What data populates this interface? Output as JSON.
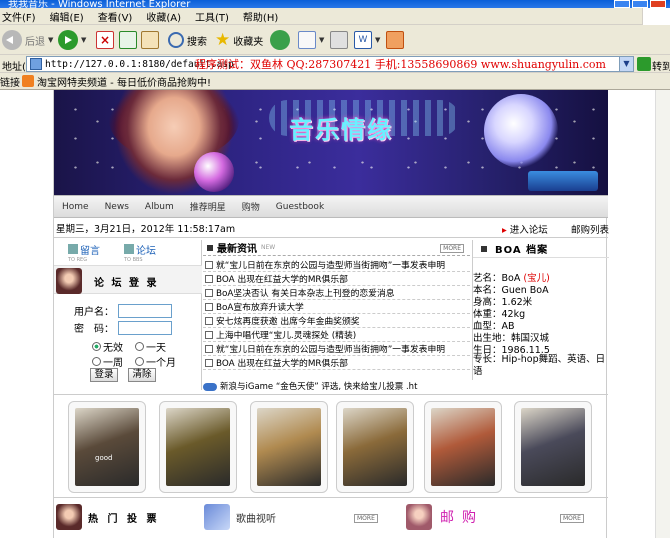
{
  "window": {
    "title": "我我音乐 - Windows Internet Explorer"
  },
  "menu": [
    "文件(F)",
    "编辑(E)",
    "查看(V)",
    "收藏(A)",
    "工具(T)",
    "帮助(H)"
  ],
  "toolbar": {
    "back": "后退",
    "search": "搜索",
    "favorites": "收藏夹"
  },
  "address": {
    "label": "地址(D)",
    "url": "http://127.0.0.1:8180/default.asp",
    "overlay": "程序测试：双鱼林 QQ:287307421 手机:13558690869 www.shuangyulin.com",
    "go": "转到"
  },
  "links": {
    "label": "链接",
    "item": "淘宝网特卖频道 - 每日低价商品抢购中!"
  },
  "banner": {
    "logo_text": "音乐情缘"
  },
  "nav": [
    "Home",
    "News",
    "Album",
    "推荐明星",
    "购物",
    "Guestbook"
  ],
  "datebar": {
    "date": "星期三，3月21日，2012年 11:58:17am",
    "forum": "进入论坛",
    "mail": "邮购列表"
  },
  "left": {
    "tab1": "留言",
    "tab1_sub": "TO REG",
    "tab2": "论坛",
    "tab2_sub": "TO BBS",
    "login_title": "论 坛 登 录",
    "username_label": "用户名：",
    "password_label": "密　码：",
    "opt_none": "无效",
    "opt_day": "一天",
    "opt_week": "一周",
    "opt_month": "一个月",
    "login_btn": "登录",
    "clear_btn": "清除"
  },
  "news": {
    "title": "最新资讯",
    "new_tag": "NEW",
    "more": "MORE",
    "items": [
      "就“宝儿日前在东京的公园与造型师当街拥吻”一事发表申明",
      "BOA 出现在红益大学的MR俱乐部",
      "BoA坚决否认 有关日本杂志上刊登的恋爱消息",
      "BoA宣布放弃升读大学",
      "安七炫再度获邀 出席今年金曲奖颁奖",
      "上海中唱代理“宝儿.灵魂探处 (精装)",
      "就“宝儿日前在东京的公园与造型师当街拥吻”一事发表申明",
      "BOA 出现在红益大学的MR俱乐部"
    ]
  },
  "profile": {
    "title": "BOA 档案",
    "rows": [
      {
        "label": "艺名：",
        "value": "BoA",
        "extra": "(宝儿)"
      },
      {
        "label": "本名：",
        "value": "Guen BoA"
      },
      {
        "label": "身高：",
        "value": "1.62米"
      },
      {
        "label": "体重：",
        "value": "42kg"
      },
      {
        "label": "血型：",
        "value": "AB"
      },
      {
        "label": "出生地：",
        "value": "韩国汉城"
      },
      {
        "label": "生日：",
        "value": "1986.11.5"
      },
      {
        "label": "专长：",
        "value": "Hip-hop舞蹈、英语、日语"
      }
    ]
  },
  "marquee": "新浪与iGame “金色天使” 评选, 快来给宝儿投票 .ht",
  "photos": [
    {
      "color": "#5a4a3a",
      "tag": "good"
    },
    {
      "color": "#6a5a2a",
      "tag": ""
    },
    {
      "color": "#b08a50",
      "tag": ""
    },
    {
      "color": "#8a6a3a",
      "tag": ""
    },
    {
      "color": "#b05a3a",
      "tag": ""
    },
    {
      "color": "#4a4a5a",
      "tag": ""
    }
  ],
  "bottom": {
    "hot": "热 门 投 票",
    "video": "歌曲视听",
    "mail": "邮购",
    "more": "MORE"
  }
}
